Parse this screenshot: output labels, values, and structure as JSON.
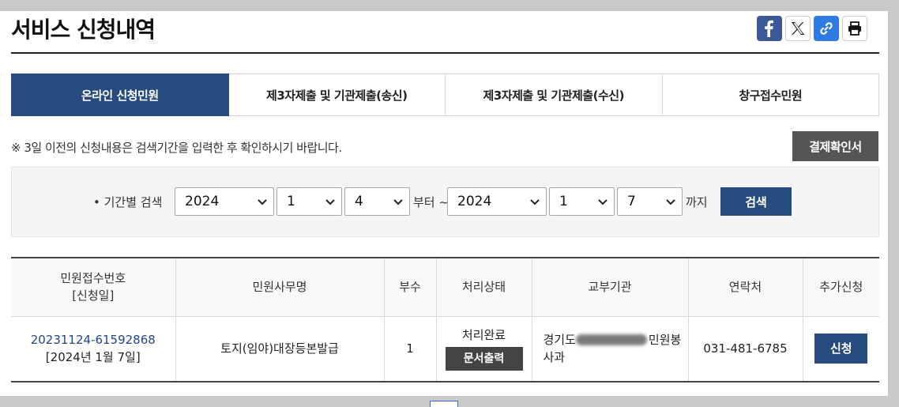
{
  "page": {
    "title": "서비스 신청내역",
    "share_icons": [
      "facebook-icon",
      "x-twitter-icon",
      "link-icon",
      "print-icon"
    ]
  },
  "tabs": [
    {
      "label": "온라인 신청민원",
      "active": true
    },
    {
      "label": "제3자제출 및 기관제출(송신)",
      "active": false
    },
    {
      "label": "제3자제출 및 기관제출(수신)",
      "active": false
    },
    {
      "label": "창구접수민원",
      "active": false
    }
  ],
  "notice": "※ 3일 이전의 신청내용은 검색기간을 입력한 후 확인하시기 바랍니다.",
  "payment_button": "결제확인서",
  "search": {
    "label": "기간별 검색",
    "from_year": "2024",
    "from_month": "1",
    "from_day": "4",
    "from_text": "부터 ~",
    "to_year": "2024",
    "to_month": "1",
    "to_day": "7",
    "to_text": "까지",
    "button": "검색"
  },
  "table": {
    "headers": {
      "receipt_line1": "민원접수번호",
      "receipt_line2": "[신청일]",
      "service": "민원사무명",
      "copies": "부수",
      "status": "처리상태",
      "org": "교부기관",
      "contact": "연락처",
      "extra": "추가신청"
    },
    "rows": [
      {
        "receipt_no": "20231124-61592868",
        "date": "[2024년 1월 7일]",
        "service": "토지(임야)대장등본발급",
        "copies": "1",
        "status": "처리완료",
        "status_button": "문서출력",
        "org_prefix": "경기도",
        "org_suffix": "민원봉",
        "org_line2": "사과",
        "contact": "031-481-6785",
        "extra_button": "신청"
      }
    ]
  },
  "colors": {
    "primary": "#274a7f",
    "dark_button": "#555555",
    "link": "#22468a"
  }
}
